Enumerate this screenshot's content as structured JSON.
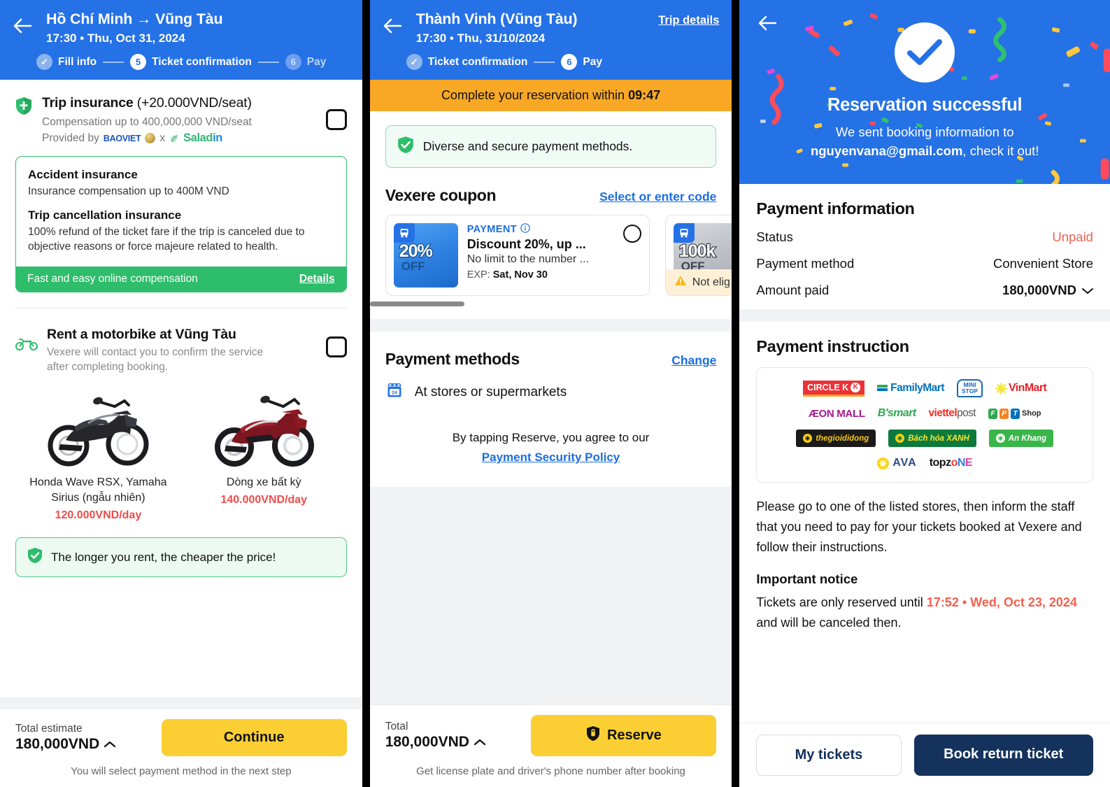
{
  "panel1": {
    "header": {
      "back_icon": "back-arrow-icon",
      "title": "Hồ Chí Minh → Vũng Tàu",
      "subtitle": "17:30 • Thu, Oct 31, 2024",
      "steps": [
        {
          "label": "Fill info",
          "badge": "✓",
          "state": "done"
        },
        {
          "label": "Ticket confirmation",
          "badge": "5",
          "state": "active"
        },
        {
          "label": "Pay",
          "badge": "6",
          "state": "todo"
        }
      ]
    },
    "insurance": {
      "icon": "shield-icon",
      "title": "Trip insurance",
      "price_suffix": "(+20.000VND/seat)",
      "compensation": "Compensation up to 400,000,000 VND/seat",
      "provided_by_label": "Provided by",
      "provider_1": "BAOVIET",
      "provider_sep": "x",
      "provider_2": "Saladin",
      "checkbox_name": "trip-insurance-checkbox",
      "card": {
        "h1": "Accident insurance",
        "p1": "Insurance compensation up to 400M VND",
        "h2": "Trip cancellation insurance",
        "p2": "100% refund of the ticket fare if the trip is canceled due to objective reasons or force majeure related to health.",
        "footer_text": "Fast and easy online compensation",
        "footer_link": "Details"
      }
    },
    "motorbike": {
      "icon": "motorbike-icon",
      "title": "Rent a motorbike at Vũng Tàu",
      "subtitle": "Vexere will contact you to confirm the service after completing booking.",
      "checkbox_name": "motorbike-rental-checkbox",
      "options": [
        {
          "name": "Honda Wave RSX, Yamaha Sirius (ngẫu nhiên)",
          "price": "120.000VND/day",
          "color": "#2b2b2f"
        },
        {
          "name": "Dòng xe bất kỳ",
          "price": "140.000VND/day",
          "color": "#8d1a23"
        }
      ],
      "tip": "The longer you rent, the cheaper the price!"
    },
    "footer": {
      "total_label": "Total estimate",
      "total_value": "180,000VND",
      "caret": "︿",
      "button": "Continue",
      "note": "You will select payment method in the next step"
    }
  },
  "panel2": {
    "header": {
      "back_icon": "back-arrow-icon",
      "title": "Thành Vinh (Vũng Tàu)",
      "subtitle": "17:30 • Thu, 31/10/2024",
      "trip_details": "Trip details",
      "steps": [
        {
          "label": "Ticket confirmation",
          "badge": "✓",
          "state": "done"
        },
        {
          "label": "Pay",
          "badge": "6",
          "state": "active"
        }
      ]
    },
    "timer_prefix": "Complete your reservation within",
    "timer_value": "09:47",
    "secure_note": "Diverse and secure payment methods.",
    "coupon": {
      "title": "Vexere coupon",
      "link": "Select or enter code",
      "items": [
        {
          "kind": "PAYMENT",
          "info_icon": "info-icon",
          "name": "Discount 20%, up ...",
          "desc": "No limit to the number ...",
          "exp_label": "EXP:",
          "exp_value": "Sat, Nov 30",
          "art_value": "20%",
          "art_off": "OFF",
          "eligible": true
        },
        {
          "art_value": "100k",
          "art_off": "OFF",
          "not_eligible_text": "Not elig",
          "eligible": false
        }
      ]
    },
    "payment_methods": {
      "title": "Payment methods",
      "change_link": "Change",
      "selected_icon": "store-icon",
      "selected": "At stores or supermarkets",
      "agree_text": "By tapping Reserve, you agree to our",
      "policy_link": "Payment Security Policy"
    },
    "footer": {
      "total_label": "Total",
      "total_value": "180,000VND",
      "caret": "︿",
      "button": "Reserve",
      "button_icon": "shield-lock-icon",
      "note": "Get license plate and driver's phone number after booking"
    }
  },
  "panel3": {
    "back_icon": "back-arrow-icon",
    "success_icon": "check-circle-icon",
    "success_title": "Reservation successful",
    "success_line1": "We sent booking information to",
    "success_email": "nguyenvana@gmail.com",
    "success_line2": ", check it out!",
    "payment_info": {
      "title": "Payment information",
      "rows": [
        {
          "key": "Status",
          "value": "Unpaid",
          "style": "red"
        },
        {
          "key": "Payment method",
          "value": "Convenient Store",
          "style": "normal"
        },
        {
          "key": "Amount paid",
          "value": "180,000VND",
          "style": "bold",
          "caret": "⌄"
        }
      ]
    },
    "instruction": {
      "title": "Payment instruction",
      "logos": [
        [
          {
            "name": "CIRCLE K",
            "type": "circlek"
          },
          {
            "name": "FamilyMart",
            "type": "familymart"
          },
          {
            "name": "MINI STOP",
            "type": "ministop"
          },
          {
            "name": "VinMart",
            "type": "vinmart"
          }
        ],
        [
          {
            "name": "ÆON MALL",
            "type": "aeon"
          },
          {
            "name": "B'smart",
            "type": "bsmart"
          },
          {
            "name": "viettel post",
            "type": "viettel"
          },
          {
            "name": "FPT Shop",
            "type": "fpt"
          }
        ],
        [
          {
            "name": "thegioididong",
            "type": "tgdd"
          },
          {
            "name": "Bách hóa XANH",
            "type": "bhx"
          },
          {
            "name": "An Khang",
            "type": "ankhang"
          }
        ],
        [
          {
            "name": "AVA",
            "type": "ava"
          },
          {
            "name": "topzone",
            "type": "topzone"
          }
        ]
      ],
      "body": "Please go to one of the listed stores, then inform the staff that you need to pay for your tickets booked at Vexere and follow their instructions.",
      "notice_title": "Important notice",
      "notice_prefix": "Tickets are only reserved until",
      "notice_deadline": "17:52 • Wed, Oct 23, 2024",
      "notice_suffix": "and will be canceled then."
    },
    "footer": {
      "my_tickets": "My tickets",
      "book_return": "Book return ticket"
    }
  },
  "colors": {
    "brand_blue": "#2571e6",
    "yellow": "#fbcf33",
    "green": "#2ebd6b",
    "orange": "#f9a826",
    "red": "#f4604e",
    "navy": "#14325c"
  }
}
